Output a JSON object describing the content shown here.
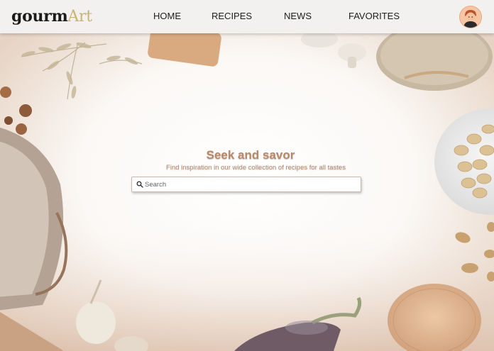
{
  "header": {
    "logo": {
      "part1": "gourm",
      "part2": "Art",
      "accent": "#c9b27a"
    },
    "nav": [
      {
        "label": "HOME"
      },
      {
        "label": "RECIPES"
      },
      {
        "label": "NEWS"
      },
      {
        "label": "FAVORITES"
      }
    ],
    "avatar_icon": "user-avatar-icon"
  },
  "hero": {
    "title": "Seek and savor",
    "subtitle": "Find inspiration in our wide collection of recipes for all tastes",
    "search": {
      "placeholder": "Search",
      "value": "",
      "icon": "search-icon"
    }
  },
  "colors": {
    "header_bg": "#f3f1f0",
    "title_text": "#b8886a",
    "logo_accent": "#c9b27a"
  }
}
